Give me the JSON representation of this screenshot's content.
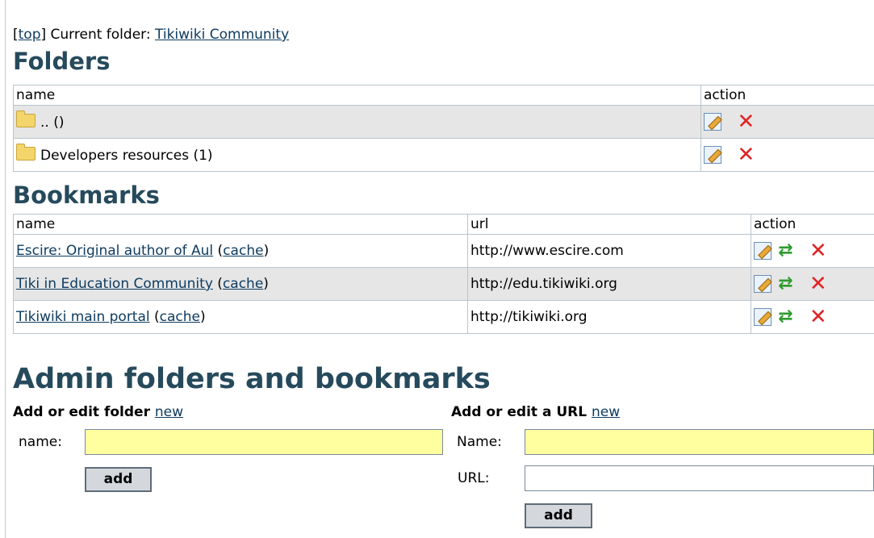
{
  "breadcrumb": {
    "open_bracket": "[",
    "top_link": "top",
    "close_text": "] Current folder: ",
    "current_folder": "Tikiwiki Community"
  },
  "folders": {
    "heading": "Folders",
    "columns": {
      "name": "name",
      "action": "action"
    },
    "rows": [
      {
        "name": ".. ()"
      },
      {
        "name": "Developers resources (1)"
      }
    ]
  },
  "bookmarks": {
    "heading": "Bookmarks",
    "columns": {
      "name": "name",
      "url": "url",
      "action": "action"
    },
    "rows": [
      {
        "name": "Escire: Original author of Aul",
        "cache": "cache",
        "url": "http://www.escire.com"
      },
      {
        "name": "Tiki in Education Community",
        "cache": "cache",
        "url": "http://edu.tikiwiki.org"
      },
      {
        "name": "Tikiwiki main portal",
        "cache": "cache",
        "url": "http://tikiwiki.org"
      }
    ]
  },
  "admin": {
    "heading": "Admin folders and bookmarks",
    "folder_form": {
      "title": "Add or edit folder",
      "new_link": "new",
      "name_label": "name:",
      "name_value": "",
      "add_button": "add"
    },
    "url_form": {
      "title": "Add or edit a URL",
      "new_link": "new",
      "name_label": "Name:",
      "name_value": "",
      "url_label": "URL:",
      "url_value": "",
      "add_button": "add"
    }
  },
  "icons": {
    "folder": "folder-icon",
    "edit": "edit-icon",
    "refresh": "refresh-icon",
    "delete": "delete-icon"
  },
  "colors": {
    "heading": "#264a5c",
    "link": "#0e3c61",
    "input_highlight": "#ffffa0",
    "odd_row": "#e6e6e6",
    "delete": "#e02323",
    "refresh": "#2f9a2f"
  }
}
